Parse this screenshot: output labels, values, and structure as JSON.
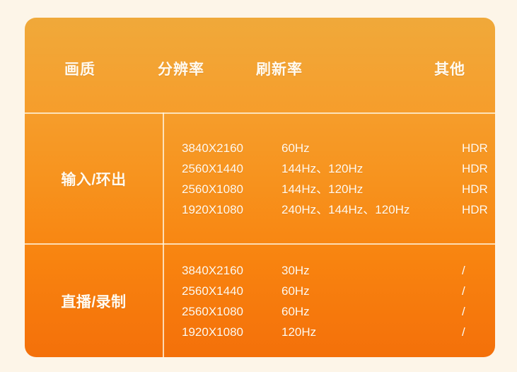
{
  "theme": {
    "page_background": "#fdf5e8",
    "card_gradient_top": "#f0a93a",
    "card_gradient_bottom": "#f4700a",
    "text_color": "#fffaf0",
    "divider_color": "#fffaeb"
  },
  "table": {
    "headers": {
      "quality": "画质",
      "resolution": "分辨率",
      "refresh_rate": "刷新率",
      "other": "其他"
    },
    "rows": [
      {
        "label": "输入/环出",
        "lines": [
          {
            "resolution": "3840X2160",
            "refresh": "60Hz",
            "other": "HDR"
          },
          {
            "resolution": "2560X1440",
            "refresh": "144Hz、120Hz",
            "other": "HDR"
          },
          {
            "resolution": "2560X1080",
            "refresh": "144Hz、120Hz",
            "other": "HDR"
          },
          {
            "resolution": "1920X1080",
            "refresh": "240Hz、144Hz、120Hz",
            "other": "HDR"
          }
        ]
      },
      {
        "label": "直播/录制",
        "lines": [
          {
            "resolution": "3840X2160",
            "refresh": "30Hz",
            "other": "/"
          },
          {
            "resolution": "2560X1440",
            "refresh": "60Hz",
            "other": "/"
          },
          {
            "resolution": "2560X1080",
            "refresh": "60Hz",
            "other": "/"
          },
          {
            "resolution": "1920X1080",
            "refresh": "120Hz",
            "other": "/"
          }
        ]
      }
    ]
  }
}
